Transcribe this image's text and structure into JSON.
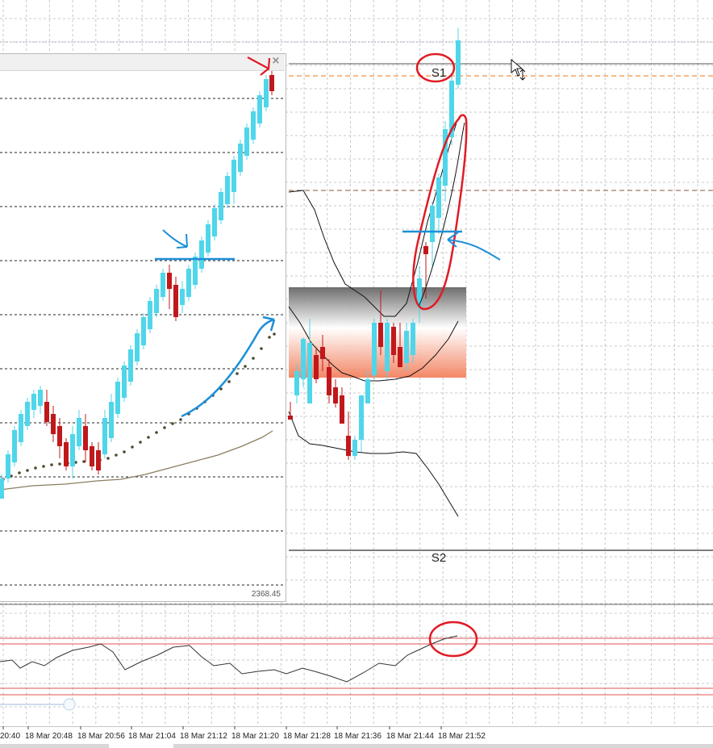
{
  "chart": {
    "levels": {
      "upper": "S1",
      "lower": "S2"
    },
    "time_labels": [
      "20:40",
      "18 Mar 20:48",
      "18 Mar 20:56",
      "18 Mar 21:04",
      "18 Mar 21:12",
      "18 Mar 21:20",
      "18 Mar 21:28",
      "18 Mar 21:36",
      "18 Mar 21:44",
      "18 Mar 21:52"
    ]
  },
  "sub_window": {
    "close_glyph": "×",
    "price_label": "2368.45"
  },
  "colors": {
    "bull": "#4fd6ea",
    "bear": "#c0181b",
    "annotation_red": "#e01b24",
    "annotation_blue": "#1c8fd8",
    "grid": "#c8c8c8",
    "zone_top": "#5e5e5e",
    "zone_bottom": "#f27a55",
    "osc_band": "#e05050"
  }
}
